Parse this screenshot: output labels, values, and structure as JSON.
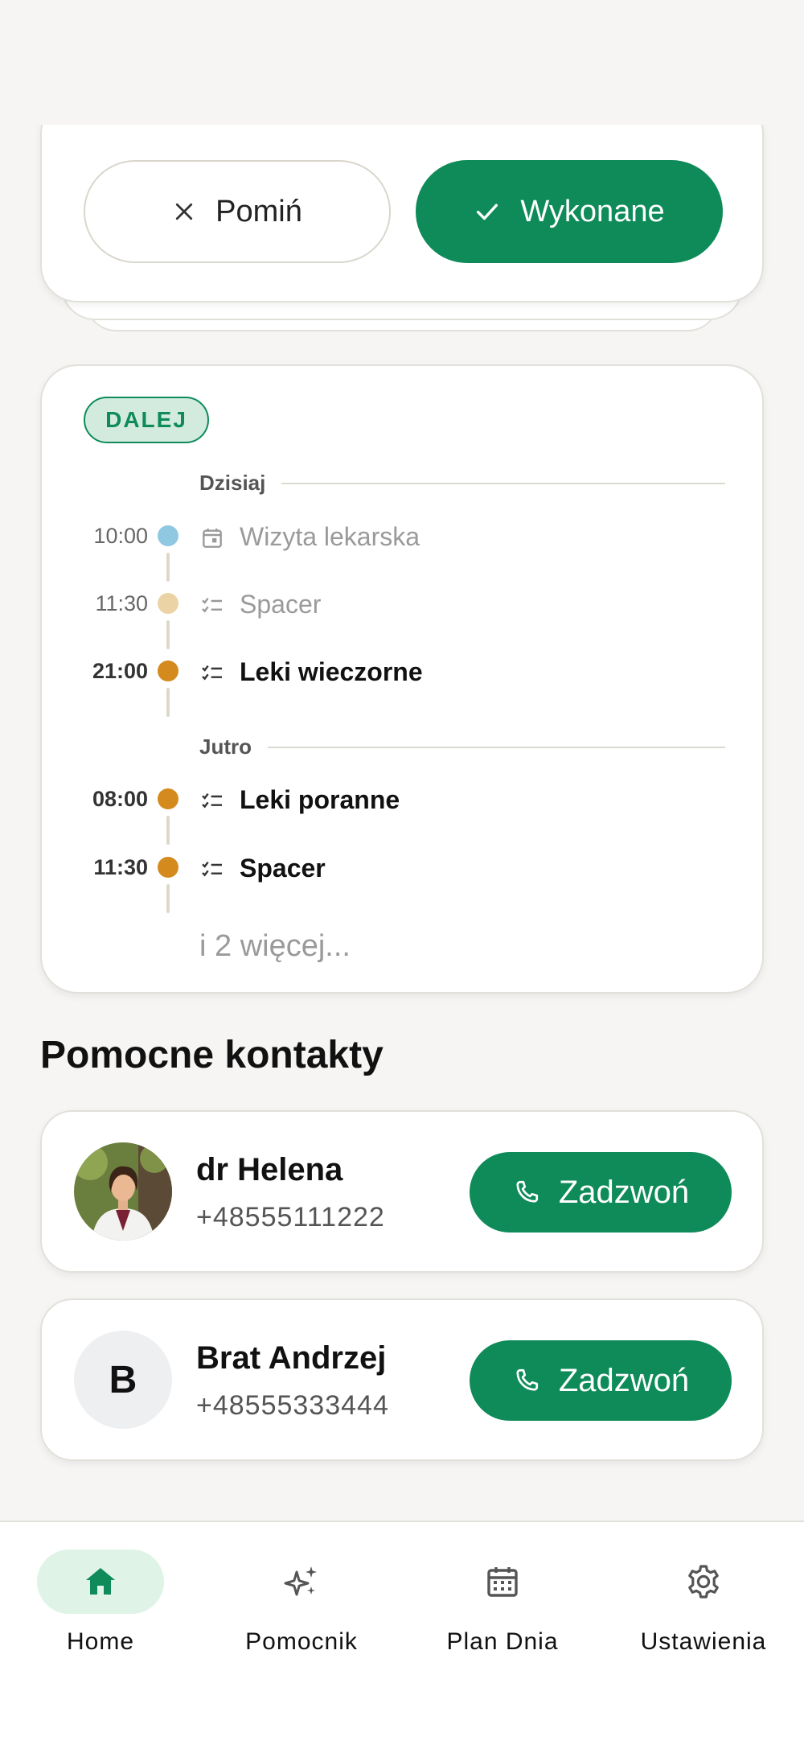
{
  "task_card": {
    "skip_label": "Pomiń",
    "done_label": "Wykonane"
  },
  "next": {
    "badge": "DALEJ",
    "groups": [
      {
        "label": "Dzisiaj",
        "items": [
          {
            "time": "10:00",
            "title": "Wizyta lekarska",
            "icon": "calendar-icon",
            "dot": "#8fc8e0",
            "state": "past"
          },
          {
            "time": "11:30",
            "title": "Spacer",
            "icon": "checklist-icon",
            "dot": "#ecd3a6",
            "state": "past"
          },
          {
            "time": "21:00",
            "title": "Leki wieczorne",
            "icon": "checklist-icon",
            "dot": "#d48a1c",
            "state": "upcoming"
          }
        ]
      },
      {
        "label": "Jutro",
        "items": [
          {
            "time": "08:00",
            "title": "Leki poranne",
            "icon": "checklist-icon",
            "dot": "#d48a1c",
            "state": "upcoming"
          },
          {
            "time": "11:30",
            "title": "Spacer",
            "icon": "checklist-icon",
            "dot": "#d48a1c",
            "state": "upcoming"
          }
        ]
      }
    ],
    "more": "i 2 więcej..."
  },
  "contacts": {
    "title": "Pomocne kontakty",
    "items": [
      {
        "name": "dr Helena",
        "phone": "+48555111222",
        "avatar": "photo",
        "call_label": "Zadzwoń"
      },
      {
        "name": "Brat Andrzej",
        "phone": "+48555333444",
        "avatar_letter": "B",
        "call_label": "Zadzwoń"
      }
    ]
  },
  "nav": {
    "items": [
      {
        "label": "Home",
        "icon": "home-icon",
        "active": true
      },
      {
        "label": "Pomocnik",
        "icon": "sparkles-icon",
        "active": false
      },
      {
        "label": "Plan Dnia",
        "icon": "calendar-icon",
        "active": false
      },
      {
        "label": "Ustawienia",
        "icon": "gear-icon",
        "active": false
      }
    ]
  },
  "colors": {
    "accent": "#0e8b58",
    "accent_light": "#d3ebdf",
    "background": "#f6f5f3"
  }
}
